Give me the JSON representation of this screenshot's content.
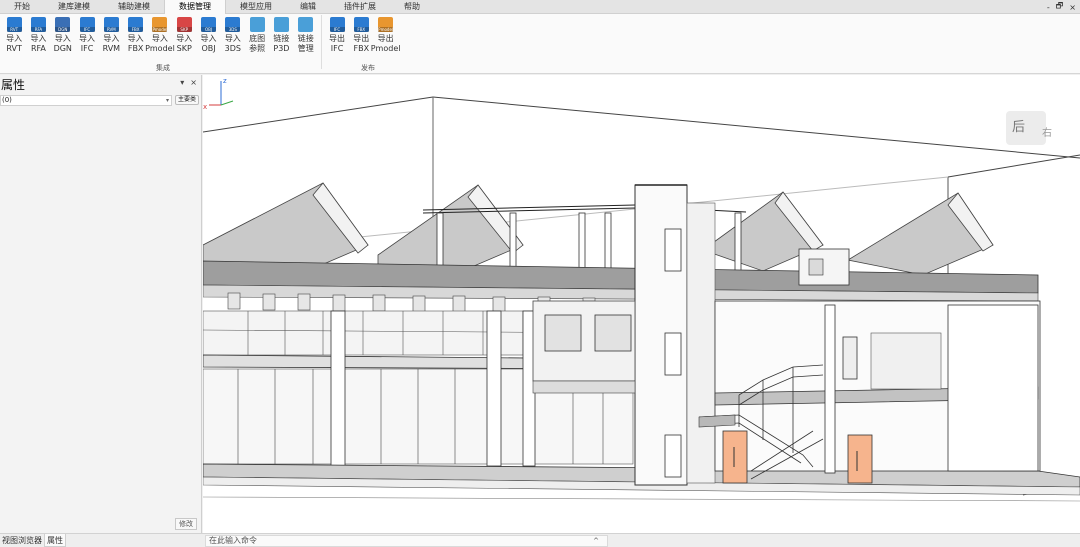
{
  "menu": {
    "tabs": [
      "开始",
      "建库建模",
      "辅助建模",
      "数据管理",
      "模型应用",
      "编辑",
      "插件扩展",
      "帮助"
    ],
    "active": "数据管理",
    "window_controls": [
      "-",
      "🗗",
      "×"
    ]
  },
  "ribbon": {
    "group_integrate": {
      "label": "集成",
      "buttons": [
        {
          "label1": "导入",
          "label2": "RVT",
          "color": "#2b7bd1",
          "tag": "RVT",
          "icon": "import-rvt-icon"
        },
        {
          "label1": "导入",
          "label2": "RFA",
          "color": "#2b7bd1",
          "tag": "RFA",
          "icon": "import-rfa-icon"
        },
        {
          "label1": "导入",
          "label2": "DGN",
          "color": "#3a6fb5",
          "tag": "DGN",
          "icon": "import-dgn-icon"
        },
        {
          "label1": "导入",
          "label2": "IFC",
          "color": "#2b7bd1",
          "tag": "IFC",
          "icon": "import-ifc-icon"
        },
        {
          "label1": "导入",
          "label2": "RVM",
          "color": "#2b7bd1",
          "tag": "RVM",
          "icon": "import-rvm-icon"
        },
        {
          "label1": "导入",
          "label2": "FBX",
          "color": "#2b7bd1",
          "tag": "FBX",
          "icon": "import-fbx-icon"
        },
        {
          "label1": "导入",
          "label2": "Pmodel",
          "color": "#e8962f",
          "tag": "Pmodel",
          "icon": "import-pmodel-icon"
        },
        {
          "label1": "导入",
          "label2": "SKP",
          "color": "#d84646",
          "tag": "SKP",
          "icon": "import-skp-icon"
        },
        {
          "label1": "导入",
          "label2": "OBJ",
          "color": "#2b7bd1",
          "tag": "OBJ",
          "icon": "import-obj-icon"
        },
        {
          "label1": "导入",
          "label2": "3DS",
          "color": "#2b7bd1",
          "tag": "3DS",
          "icon": "import-3ds-icon"
        },
        {
          "label1": "底图",
          "label2": "参照",
          "color": "#4a9fd8",
          "tag": "",
          "icon": "basemap-reference-icon"
        },
        {
          "label1": "链接",
          "label2": "P3D",
          "color": "#4a9fd8",
          "tag": "",
          "icon": "link-p3d-icon"
        },
        {
          "label1": "链接",
          "label2": "管理",
          "color": "#4a9fd8",
          "tag": "",
          "icon": "link-manage-icon"
        }
      ]
    },
    "group_publish": {
      "label": "发布",
      "buttons": [
        {
          "label1": "导出",
          "label2": "IFC",
          "color": "#2b7bd1",
          "tag": "IFC",
          "icon": "export-ifc-icon"
        },
        {
          "label1": "导出",
          "label2": "FBX",
          "color": "#2b7bd1",
          "tag": "FBX",
          "icon": "export-fbx-icon"
        },
        {
          "label1": "导出",
          "label2": "Pmodel",
          "color": "#e8962f",
          "tag": "Pmodel",
          "icon": "export-pmodel-icon"
        }
      ]
    }
  },
  "properties_panel": {
    "title": "属性",
    "pin": "▾",
    "close": "×",
    "selector_value": "(0)",
    "edit_type_button": "主要类",
    "modify_button": "修改"
  },
  "bottom": {
    "tabs": [
      "视图浏览器",
      "属性"
    ],
    "active_tab": "属性",
    "command_placeholder": "在此输入命令",
    "command_caret": "^"
  },
  "viewport": {
    "navcube_face": "后",
    "navcube_side": "右",
    "axis_labels": {
      "x": "x",
      "z": "z"
    }
  }
}
